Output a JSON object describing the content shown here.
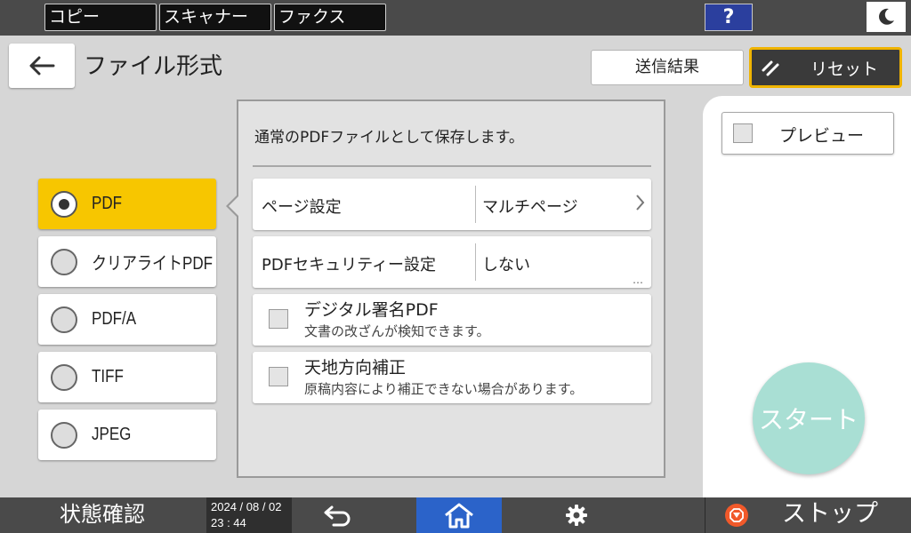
{
  "topbar": {
    "apps": [
      "コピー",
      "スキャナー",
      "ファクス"
    ],
    "help": "?",
    "colors": {
      "help_bg": "#2b3f9e"
    }
  },
  "header": {
    "title": "ファイル形式",
    "result_button": "送信結果",
    "reset_button": "リセット",
    "colors": {
      "reset_border": "#f0b400"
    }
  },
  "formats": {
    "items": [
      "PDF",
      "クリアライトPDF",
      "PDF/A",
      "TIFF",
      "JPEG"
    ],
    "selected": "PDF",
    "colors": {
      "selected_bg": "#f7c600"
    }
  },
  "panel": {
    "description": "通常のPDFファイルとして保存します。",
    "settings": [
      {
        "name": "ページ設定",
        "value": "マルチページ"
      },
      {
        "name": "PDFセキュリティー設定",
        "value": "しない"
      }
    ],
    "more": "…",
    "options": [
      {
        "title": "デジタル署名PDF",
        "subtitle": "文書の改ざんが検知できます。",
        "checked": false
      },
      {
        "title": "天地方向補正",
        "subtitle": "原稿内容により補正できない場合があります。",
        "checked": false
      }
    ]
  },
  "side": {
    "preview": "プレビュー",
    "preview_checked": false,
    "start": "スタート",
    "colors": {
      "start_bg": "#a9dfd4"
    }
  },
  "bottombar": {
    "status": "状態確認",
    "date": "2024 / 08 / 02",
    "time": "23 : 44",
    "stop": "ストップ",
    "colors": {
      "home_bg": "#2b63c9",
      "stop_icon": "#f1592a"
    }
  }
}
